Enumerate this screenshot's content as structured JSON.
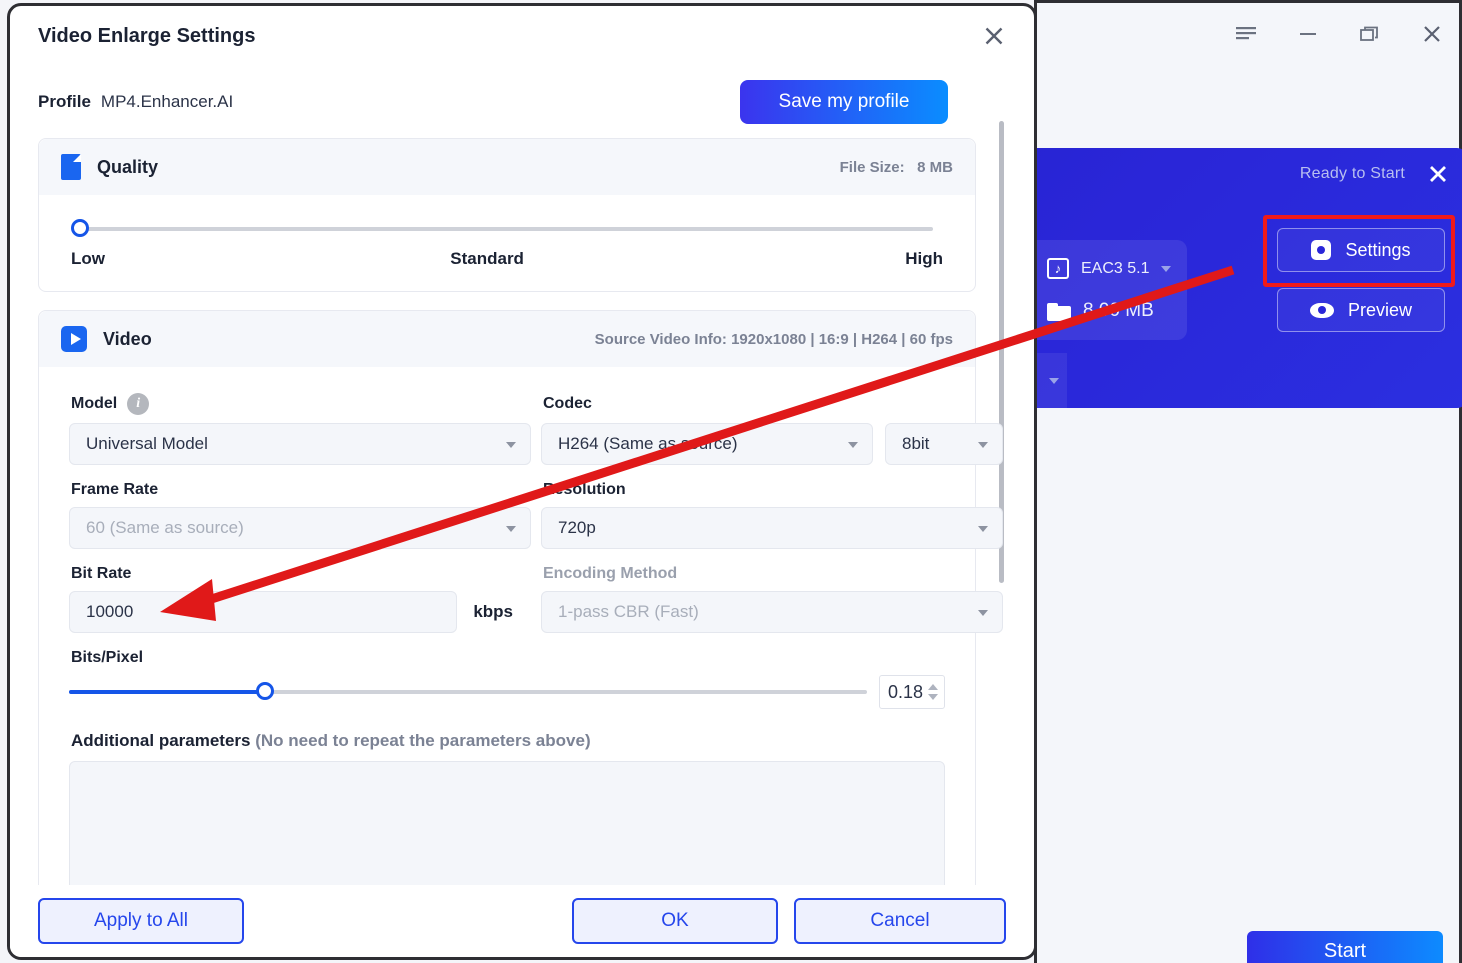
{
  "dialog": {
    "title": "Video Enlarge Settings",
    "close_icon": "close-icon",
    "profile_label": "Profile",
    "profile_value": "MP4.Enhancer.AI",
    "save_profile_label": "Save my profile",
    "quality": {
      "icon": "document-icon",
      "title": "Quality",
      "file_size_label": "File Size:",
      "file_size_value": "8 MB",
      "slider_value": 0,
      "ticks": {
        "low": "Low",
        "standard": "Standard",
        "high": "High"
      }
    },
    "video": {
      "icon": "video-play-icon",
      "title": "Video",
      "source_info": "Source Video Info: 1920x1080 | 16:9 | H264 | 60 fps",
      "model": {
        "label": "Model",
        "info_icon": "info-icon",
        "value": "Universal Model"
      },
      "codec": {
        "label": "Codec",
        "value": "H264 (Same as source)",
        "depth_value": "8bit"
      },
      "frame_rate": {
        "label": "Frame Rate",
        "value": "60 (Same as source)"
      },
      "resolution": {
        "label": "Resolution",
        "value": "720p"
      },
      "bit_rate": {
        "label": "Bit Rate",
        "value": "10000",
        "unit": "kbps"
      },
      "encoding_method": {
        "label": "Encoding Method",
        "value": "1-pass CBR (Fast)"
      },
      "bits_pixel": {
        "label": "Bits/Pixel",
        "value": "0.18",
        "slider_pct": 24.5
      },
      "additional": {
        "label": "Additional parameters",
        "hint": "(No need to repeat the parameters above)",
        "value": "",
        "placeholder": ""
      }
    },
    "footer": {
      "apply_to_all": "Apply to All",
      "ok": "OK",
      "cancel": "Cancel"
    }
  },
  "app": {
    "titlebar": {
      "menu_icon": "hamburger-menu-icon",
      "minimize_icon": "minimize-icon",
      "restore_icon": "restore-icon",
      "close_icon": "close-icon"
    },
    "media_card": {
      "status": "Ready to Start",
      "close_icon": "close-icon",
      "audio_icon": "music-note-icon",
      "audio_value": "EAC3 5.1",
      "file_icon": "folder-icon",
      "file_size": "8.00 MB",
      "settings_button": "Settings",
      "settings_icon": "gear-icon",
      "preview_button": "Preview",
      "preview_icon": "eye-icon"
    },
    "start_button": "Start"
  },
  "annotation": {
    "highlight_color": "#f01a1a",
    "arrow_color": "#e01919"
  }
}
